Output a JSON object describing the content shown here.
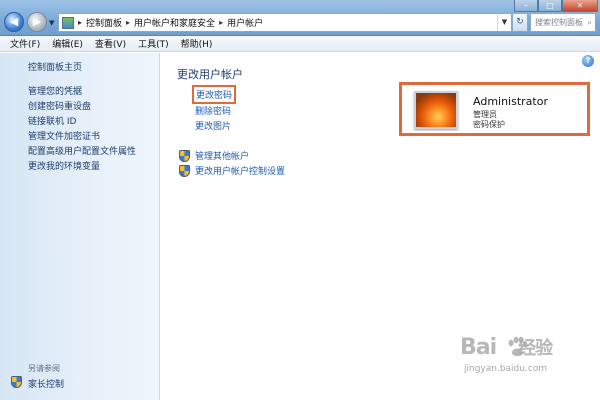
{
  "address": {
    "crumbs": [
      "控制面板",
      "用户帐户和家庭安全",
      "用户帐户"
    ],
    "search_placeholder": "搜索控制面板"
  },
  "menu": [
    "文件(F)",
    "编辑(E)",
    "查看(V)",
    "工具(T)",
    "帮助(H)"
  ],
  "sidebar": {
    "home": "控制面板主页",
    "items": [
      "管理您的凭据",
      "创建密码重设盘",
      "链接联机 ID",
      "管理文件加密证书",
      "配置高级用户配置文件属性",
      "更改我的环境变量"
    ],
    "see_also": "另请参阅",
    "parental": "家长控制"
  },
  "main": {
    "heading": "更改用户帐户",
    "tasks": [
      "更改密码",
      "删除密码",
      "更改图片"
    ],
    "shield_tasks": [
      "管理其他帐户",
      "更改用户帐户控制设置"
    ],
    "account": {
      "name": "Administrator",
      "role": "管理员",
      "status": "密码保护"
    }
  },
  "watermark": {
    "logo": "Bai",
    "logo2": "经验",
    "url": "jingyan.baidu.com"
  },
  "colors": {
    "highlight": "#e06a3b",
    "link": "#1e5ab4",
    "heading": "#1e3c78"
  }
}
